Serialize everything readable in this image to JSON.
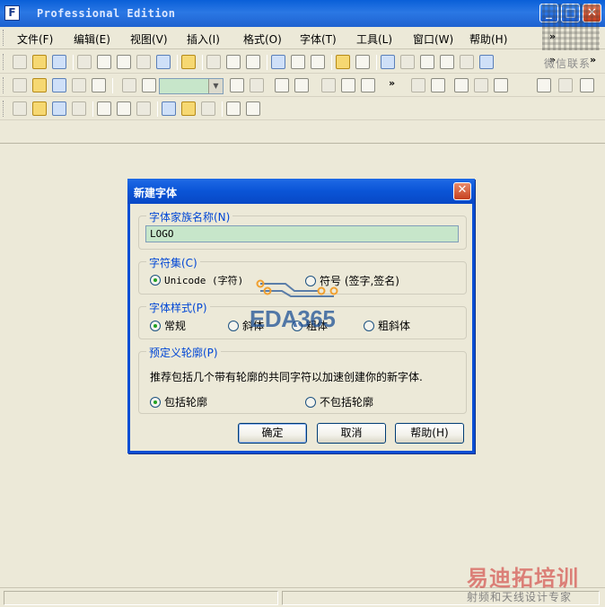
{
  "window": {
    "title": "Professional Edition",
    "app_icon": "F"
  },
  "titlebar_buttons": {
    "minimize_glyph": "_",
    "maximize_glyph": "□",
    "close_glyph": "✕"
  },
  "menubar": {
    "items": [
      {
        "label": "文件(F)"
      },
      {
        "label": "编辑(E)"
      },
      {
        "label": "视图(V)"
      },
      {
        "label": "插入(I)"
      },
      {
        "label": "格式(O)"
      },
      {
        "label": "字体(T)"
      },
      {
        "label": "工具(L)"
      },
      {
        "label": "窗口(W)"
      },
      {
        "label": "帮助(H)"
      }
    ],
    "overflow_glyph": "»"
  },
  "toolbars": {
    "overflow_glyph": "»",
    "toolbar1_icons": [
      "new-icon",
      "new-font-icon",
      "open-folder-icon",
      "save-icon",
      "save-all-icon",
      "copy-page-icon",
      "export-icon",
      "print-icon",
      "find-icon",
      "cut-icon",
      "copy-icon",
      "paste-icon",
      "undo-icon",
      "redo-icon",
      "refresh-icon",
      "insert-icon",
      "properties-icon",
      "sort-icon",
      "checkbox-icon",
      "text-icon",
      "stamp-icon",
      "check-icon",
      "more-icon"
    ],
    "toolbar2_icons": [
      "select-rect-icon",
      "lasso-icon",
      "hand-icon",
      "measure-icon",
      "pen-icon",
      "zoom-in-icon",
      "zoom-out-icon",
      "fit-icon",
      "grid-toggle-icon",
      "fill-icon",
      "node-icon",
      "image-icon",
      "edit-image-icon",
      "brush-icon",
      "grid-icon",
      "grid-plus-icon",
      "snap-icon",
      "snap-node-icon",
      "glyph-metrics-icon",
      "percent-icon",
      "network-icon",
      "hint-icon"
    ],
    "toolbar3_icons": [
      "align-left-icon",
      "align-center-icon",
      "align-right-icon",
      "align-bottom-icon",
      "distribute-left-icon",
      "distribute-center-icon",
      "distribute-right-icon",
      "distribute-top-icon",
      "distribute-middle-icon",
      "distribute-bottom-icon",
      "spacing-h-icon",
      "spacing-v-icon"
    ],
    "zoom_combo_value": ""
  },
  "dialog": {
    "title": "新建字体",
    "close_glyph": "✕",
    "family_group": {
      "legend": "字体家族名称(N)",
      "value": "LOGO"
    },
    "charset_group": {
      "legend": "字符集(C)",
      "options": [
        {
          "label": "Unicode (字符)",
          "selected": true
        },
        {
          "label": "符号 (签字,签名)",
          "selected": false
        }
      ]
    },
    "style_group": {
      "legend": "字体样式(P)",
      "options": [
        {
          "label": "常规",
          "selected": true
        },
        {
          "label": "斜体",
          "selected": false
        },
        {
          "label": "粗体",
          "selected": false
        },
        {
          "label": "粗斜体",
          "selected": false
        }
      ]
    },
    "outline_group": {
      "legend": "预定义轮廓(P)",
      "description": "推荐包括几个带有轮廓的共同字符以加速创建你的新字体.",
      "options": [
        {
          "label": "包括轮廓",
          "selected": true
        },
        {
          "label": "不包括轮廓",
          "selected": false
        }
      ]
    },
    "buttons": {
      "ok": "确定",
      "cancel": "取消",
      "help": "帮助(H)"
    }
  },
  "watermarks": {
    "qr_caption": "微信联系",
    "center_logo": "EDA365",
    "brand": "易迪拓培训",
    "brand_subtitle": "射频和天线设计专家"
  }
}
